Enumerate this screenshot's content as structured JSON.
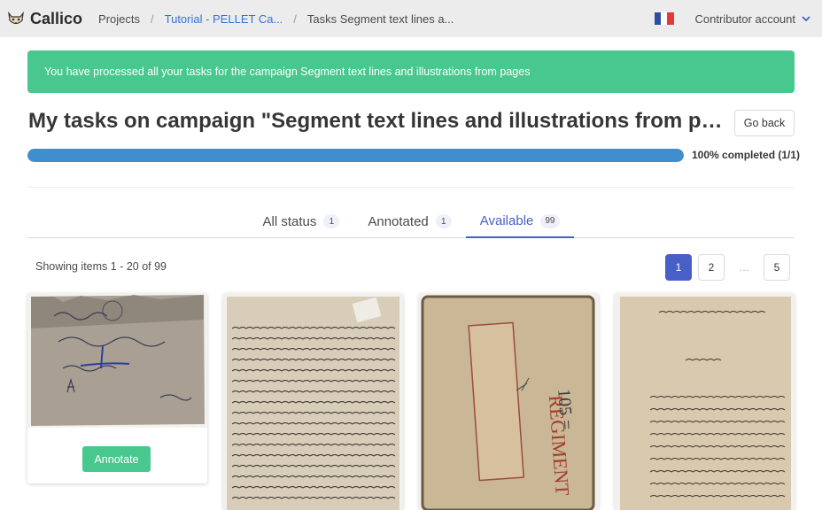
{
  "brand": {
    "name": "Callico"
  },
  "breadcrumb": [
    {
      "label": "Projects"
    },
    {
      "label": "Tutorial - PELLET Ca..."
    },
    {
      "label": "Tasks Segment text lines a..."
    }
  ],
  "account": {
    "label": "Contributor account"
  },
  "notice": {
    "text": "You have processed all your tasks for the campaign Segment text lines and illustrations from pages"
  },
  "page": {
    "title": "My tasks on campaign \"Segment text lines and illustrations from pages\"",
    "go_back": "Go back"
  },
  "progress": {
    "fraction": 1.0,
    "label": "100% completed (1/1)"
  },
  "tabs": [
    {
      "label": "All status",
      "count": "1"
    },
    {
      "label": "Annotated",
      "count": "1"
    },
    {
      "label": "Available",
      "count": "99"
    }
  ],
  "showing": "Showing items 1 - 20 of 99",
  "pagination": [
    "1",
    "2",
    "…",
    "5"
  ],
  "cards": [
    {
      "annotate_label": "Annotate"
    }
  ],
  "colors": {
    "success": "#48c78e",
    "primary": "#485fc7",
    "progress": "#3e8ed0"
  }
}
